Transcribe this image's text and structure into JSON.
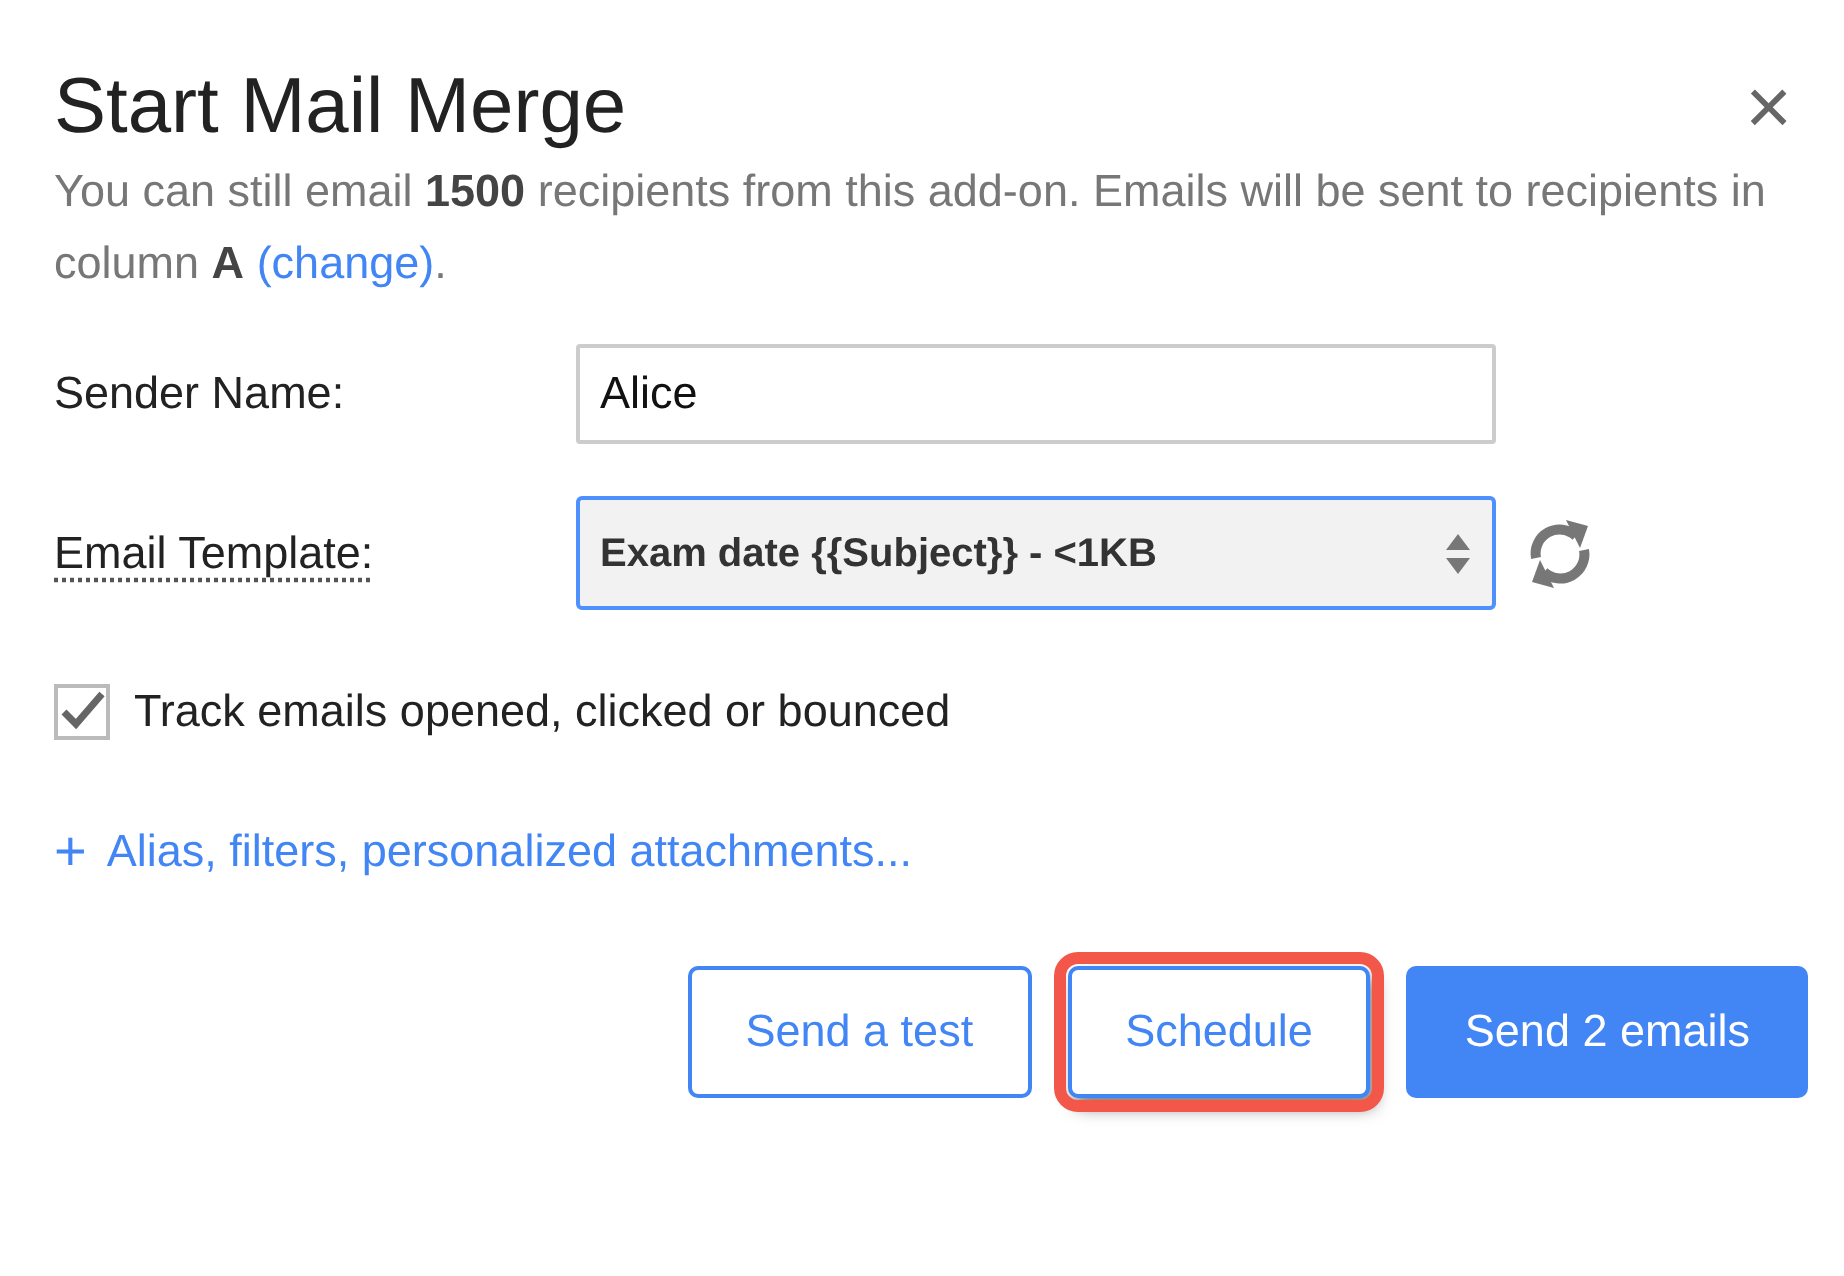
{
  "dialog": {
    "title": "Start Mail Merge",
    "close": "×"
  },
  "intro": "You can still email **1500** recipients from this add-on. Emails will be sent to recipients in column **A**",
  "intro_link": "(change)",
  "intro_end": ".",
  "fields": [
    {
      "kind": "text",
      "label": "Sender Name:",
      "value": "Alice"
    },
    {
      "kind": "select",
      "label": "Email Template:",
      "value": "Exam date {{Subject}} - <1KB",
      "focused": true
    }
  ],
  "track": {
    "label": "Track emails opened, clicked or bounced",
    "checked": true
  },
  "more_link": {
    "icon": "+",
    "label": "Alias, filters, personalized attachments..."
  },
  "buttons": [
    {
      "kind": "outline",
      "label": "Send a test",
      "highlighted": false
    },
    {
      "kind": "outline",
      "label": "Schedule",
      "highlighted": true
    },
    {
      "kind": "primary",
      "label": "Send 2 emails",
      "highlighted": false
    }
  ]
}
